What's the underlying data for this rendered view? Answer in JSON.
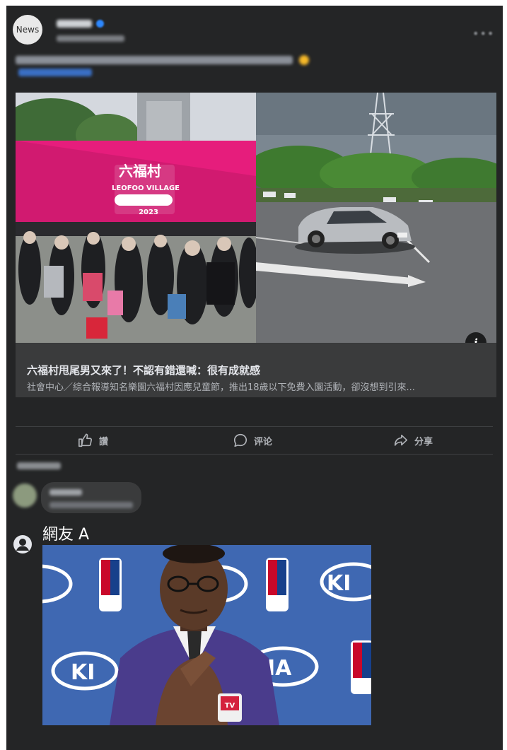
{
  "post": {
    "page_avatar_text": "News",
    "link_card": {
      "title": "六福村甩尾男又來了！不認有錯還喊：很有成就感",
      "description": "社會中心／綜合報導知名樂園六福村因應兒童節，推出18歲以下免費入園活動，卻沒想到引來..."
    },
    "photo_left": {
      "sign_text": "六福村",
      "sign_subtext": "LEOFOO VILLAGE",
      "year": "2023"
    },
    "actions": {
      "like_label": "讚",
      "comment_label": "评论",
      "share_label": "分享"
    }
  },
  "comment": {
    "author": "網友 A"
  },
  "colors": {
    "card_bg": "#242526",
    "link_bg": "#3a3b3c",
    "text_primary": "#e4e6eb",
    "text_secondary": "#b0b3b8",
    "accent_blue": "#2d88ff"
  }
}
